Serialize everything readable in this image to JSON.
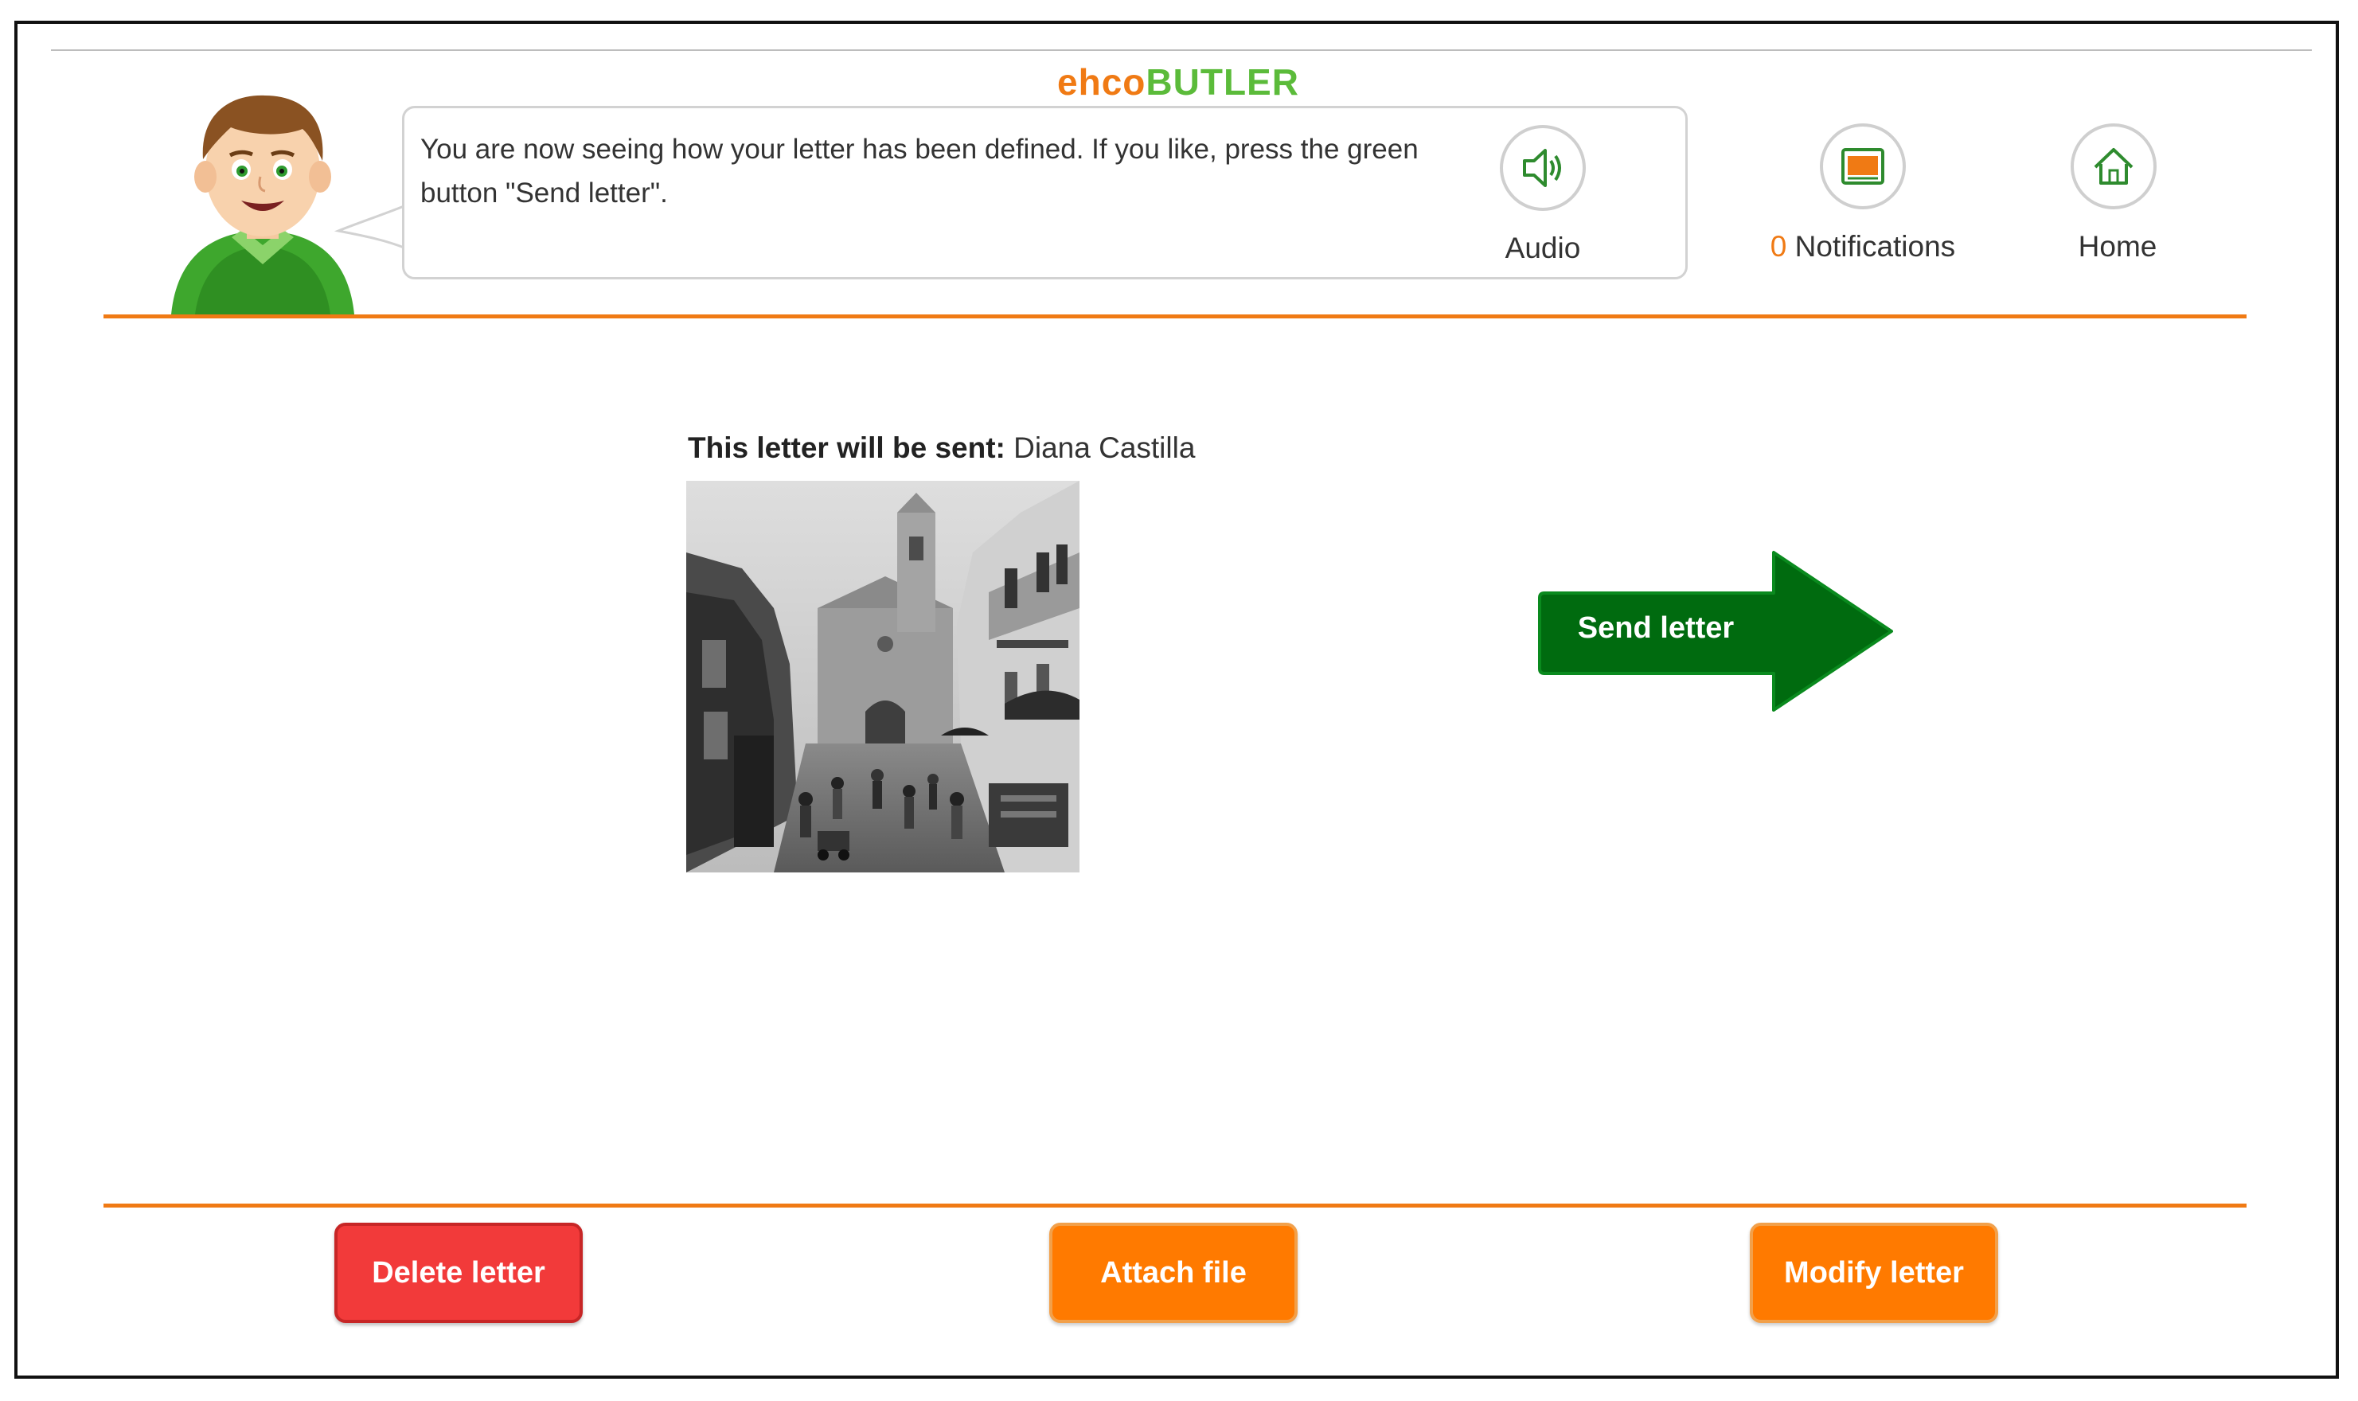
{
  "header": {
    "brand_part1": "ehco",
    "brand_part2": "BUTLER",
    "brand_colors": {
      "part1": "#f07a14",
      "part2": "#5bbb3a"
    },
    "assistant_message": "You are now seeing how your letter has been defined. If you like, press the green button \"Send letter\".",
    "audio": {
      "icon": "speaker-icon",
      "label": "Audio"
    },
    "notifications": {
      "icon": "notifications-icon",
      "count": "0",
      "label": " Notifications"
    },
    "home": {
      "icon": "home-icon",
      "label": "Home"
    }
  },
  "main": {
    "recipient_label": "This letter will be sent:",
    "recipient_name": " Diana Castilla",
    "send_button": {
      "label": "Send letter",
      "color": "#006b0f",
      "icon": "right-arrow"
    }
  },
  "footer": {
    "delete_button": {
      "label": "Delete letter",
      "color": "#f23a3a"
    },
    "attach_button": {
      "label": "Attach file",
      "color": "#ff7a00"
    },
    "modify_button": {
      "label": "Modify letter",
      "color": "#ff7a00"
    }
  },
  "theme": {
    "accent": "#f07a14",
    "divider": "#f07a14"
  }
}
